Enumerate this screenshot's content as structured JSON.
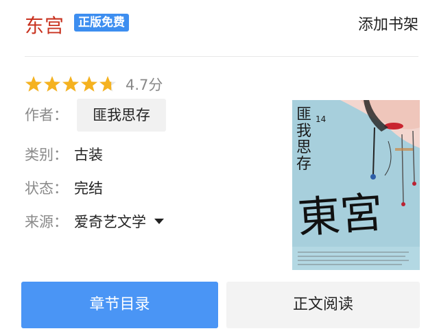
{
  "header": {
    "title": "东宫",
    "badge": "正版免费",
    "add_shelf_label": "添加书架"
  },
  "rating": {
    "stars": 4.7,
    "score_text": "4.7分",
    "star_color": "#f5b21f"
  },
  "info": {
    "author_label": "作者：",
    "author_value": "匪我思存",
    "category_label": "类别：",
    "category_value": "古装",
    "status_label": "状态：",
    "status_value": "完结",
    "source_label": "来源：",
    "source_value": "爱奇艺文学"
  },
  "cover": {
    "author_text": "匪我思存",
    "book_title": "東宮",
    "number": "14"
  },
  "actions": {
    "toc_label": "章节目录",
    "read_label": "正文阅读"
  },
  "colors": {
    "title": "#c8321f",
    "badge_bg": "#3d8ef0",
    "primary_btn": "#4a95f5"
  }
}
